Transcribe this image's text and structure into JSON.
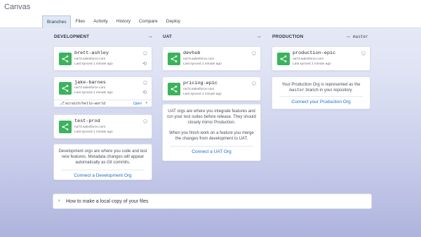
{
  "app": {
    "title": "Canvas"
  },
  "tabs": [
    {
      "label": "Branches",
      "active": true
    },
    {
      "label": "Files"
    },
    {
      "label": "Activity"
    },
    {
      "label": "History"
    },
    {
      "label": "Compare"
    },
    {
      "label": "Deploy"
    }
  ],
  "columns": {
    "development": {
      "title": "DEVELOPMENT",
      "arrow": "→"
    },
    "uat": {
      "title": "UAT",
      "arrow": "→"
    },
    "production": {
      "title": "PRODUCTION",
      "arrow": "→",
      "branch": "master"
    }
  },
  "dev_orgs": [
    {
      "name": "brett-ashley",
      "url": "na73.salesforce.com",
      "sync": "Last synced 1 minute ago"
    },
    {
      "name": "jake-barnes",
      "url": "na73.salesforce.com",
      "sync": "Last synced 1 minute ago",
      "branch": "scratch/hello-world",
      "open_label": "Open"
    },
    {
      "name": "test-prod",
      "url": "na73.salesforce.com",
      "sync": "Last synced 1 minute ago"
    }
  ],
  "dev_info": {
    "text": "Development orgs are where you code and test new features. Metadata changes will appear automatically as Git commits.",
    "link": "Connect a Development Org"
  },
  "uat_orgs": [
    {
      "name": "devhub",
      "url": "na73.salesforce.com",
      "sync": "Last synced 1 minute ago"
    },
    {
      "name": "pricing-epic",
      "url": "na73.salesforce.com",
      "sync": "Last synced 1 minute ago"
    }
  ],
  "uat_info": {
    "text1": "UAT orgs are where you integrate features and run your test suites before release. They should closely mirror Production.",
    "text2": "When you finish work on a feature you merge the changes from development to UAT.",
    "link": "Connect a UAT Org"
  },
  "prod_org": {
    "name": "production-epic",
    "url": "na73.salesforce.com",
    "sync": "Last synced 1 minute ago"
  },
  "prod_info": {
    "text_before": "Your Production Org is represented as the",
    "branch": "master",
    "text_after": "branch in your repository.",
    "link": "Connect your Production Org"
  },
  "accordion": {
    "label": "How to make a local copy of your files"
  },
  "colors": {
    "accent": "#1a6ad8",
    "org_icon": "#3bb35c"
  }
}
